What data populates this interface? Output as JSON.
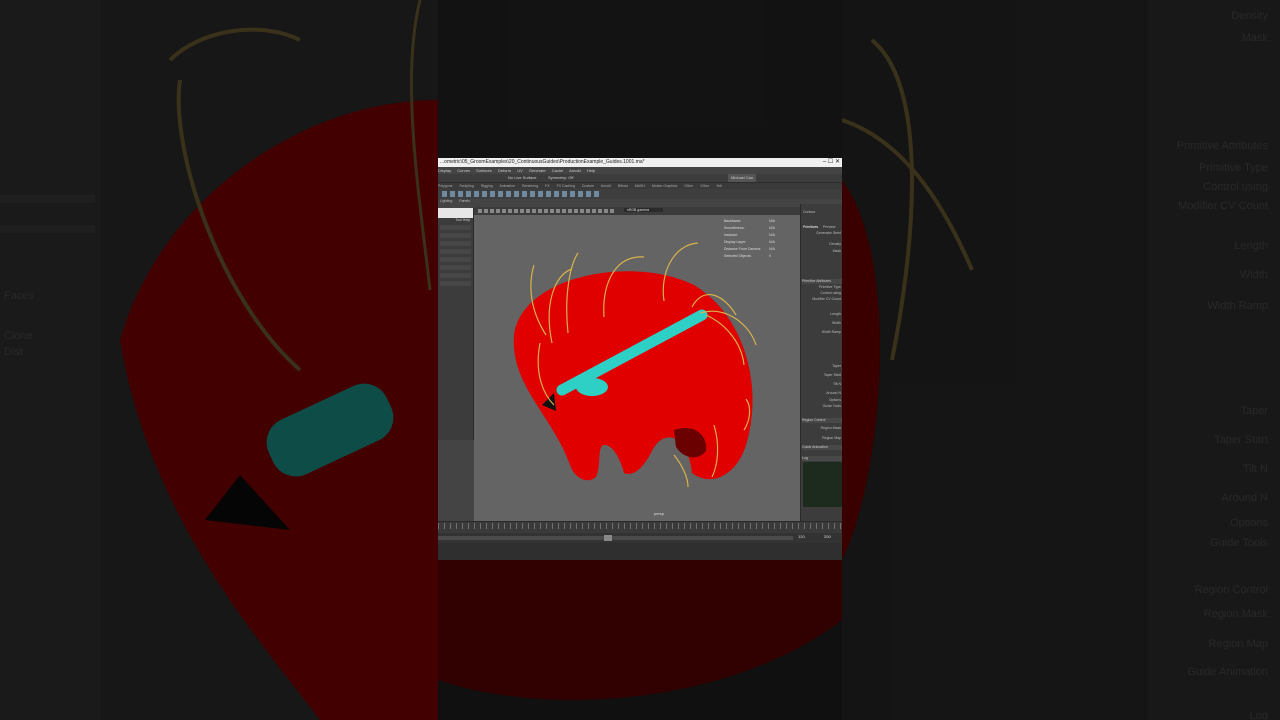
{
  "window": {
    "title": "...ometric\\05_GroomExamples\\20_ContinuousGuides\\ProductionExample_Guides.1001.ma*",
    "controls": "–  ☐  ✕"
  },
  "menubar": {
    "items": [
      "Display",
      "Curves",
      "Surfaces",
      "Deform",
      "UV",
      "Generate",
      "Cache",
      "Arnold",
      "Help"
    ]
  },
  "statusline": {
    "mode_field": "No Live Surface",
    "symmetry": "Symmetry: Off",
    "user": "Michael Cau"
  },
  "shelf_tabs": [
    "Polygons",
    "Sculpting",
    "Rigging",
    "Animation",
    "Rendering",
    "FX",
    "FX Caching",
    "Custom",
    "Arnold",
    "Bifrost",
    "MASH",
    "Motion Graphics",
    "XGen",
    "XGen",
    "Yeti"
  ],
  "small_toolbar": {
    "items": [
      "Lighting",
      "Panels"
    ]
  },
  "left_panel": {
    "tool_label": "Tool Help"
  },
  "viewport": {
    "hud": [
      {
        "label": "Backfaces:",
        "value": "N/A"
      },
      {
        "label": "Smoothness:",
        "value": "N/A"
      },
      {
        "label": "Instance:",
        "value": "N/A"
      },
      {
        "label": "Display Layer:",
        "value": "N/A"
      },
      {
        "label": "Distance From Camera:",
        "value": "N/A"
      },
      {
        "label": "Selected Objects:",
        "value": "0"
      }
    ],
    "camera_label": "persp",
    "toolbar_field": "sRGB gamma"
  },
  "right_panel": {
    "header": "Contour",
    "tabs": [
      "Primitives",
      "Preview",
      "Utilities"
    ],
    "fields": [
      "Generator Seed",
      "Density",
      "Mask"
    ],
    "primitive_section": "Primitive Attributes",
    "primitive_fields": [
      "Primitive Type",
      "Control using",
      "Modifier CV Count",
      "Length",
      "Width",
      "Width Ramp",
      "Taper",
      "Taper Start",
      "Tilt N",
      "Around N",
      "Options",
      "Guide Tools"
    ],
    "region_section": "Region Control",
    "region_fields": [
      "Region Mask",
      "Region Map"
    ],
    "guide_section": "Guide Animation",
    "log_section": "Log"
  },
  "timeline": {
    "start": "120",
    "end": "200"
  },
  "background": {
    "right_labels": [
      "Density",
      "Mask",
      "Primitive Attributes",
      "Primitive Type",
      "Control using",
      "Modifier CV Count",
      "Length",
      "Width",
      "Width Ramp",
      "Taper",
      "Taper Start",
      "Tilt N",
      "Around N",
      "Options",
      "Guide Tools",
      "Region Control",
      "Region Mask",
      "Region Map",
      "Guide Animation",
      "Log"
    ],
    "left_labels": [
      "Faces",
      "Clone",
      "Dist"
    ]
  },
  "colors": {
    "head": "#e00000",
    "guides": "#d9b24a",
    "brush_stroke": "#2ecfc4",
    "viewport_bg": "#646464"
  }
}
